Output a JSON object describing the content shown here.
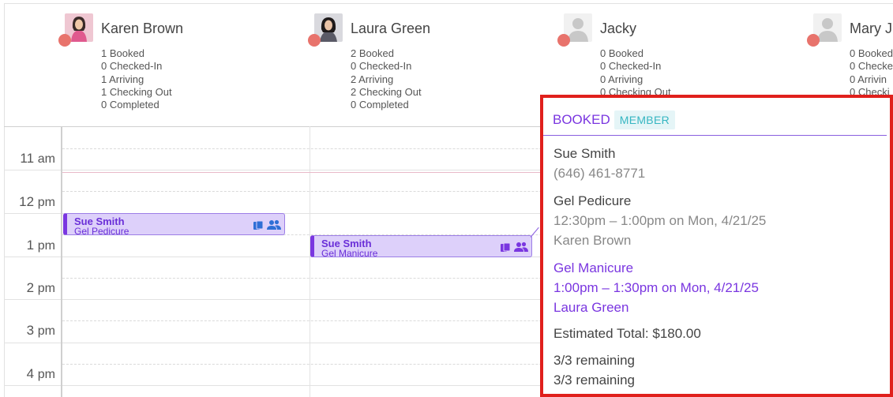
{
  "staff": [
    {
      "name": "Karen Brown",
      "avatar": "photo",
      "stats": [
        "1 Booked",
        "0 Checked-In",
        "1 Arriving",
        "1 Checking Out",
        "0 Completed"
      ]
    },
    {
      "name": "Laura Green",
      "avatar": "photo",
      "stats": [
        "2 Booked",
        "0 Checked-In",
        "2 Arriving",
        "2 Checking Out",
        "0 Completed"
      ]
    },
    {
      "name": "Jacky",
      "avatar": "placeholder",
      "stats": [
        "0 Booked",
        "0 Checked-In",
        "0 Arriving",
        "0 Checking Out"
      ]
    },
    {
      "name": "Mary J",
      "avatar": "placeholder",
      "stats": [
        "0 Booked",
        "0 Checke",
        "0 Arrivin",
        "0 Checki"
      ]
    }
  ],
  "times": [
    {
      "num": "11",
      "unit": "am"
    },
    {
      "num": "12",
      "unit": "pm"
    },
    {
      "num": "1",
      "unit": "pm"
    },
    {
      "num": "2",
      "unit": "pm"
    },
    {
      "num": "3",
      "unit": "pm"
    },
    {
      "num": "4",
      "unit": "pm"
    }
  ],
  "appointments": [
    {
      "client": "Sue Smith",
      "service": "Gel Pedicure"
    },
    {
      "client": "Sue Smith",
      "service": "Gel Manicure"
    }
  ],
  "popover": {
    "status": "BOOKED",
    "badge": "MEMBER",
    "client_name": "Sue Smith",
    "client_phone": "(646) 461-8771",
    "service1": {
      "name": "Gel Pedicure",
      "time": "12:30pm – 1:00pm on Mon, 4/21/25",
      "staff": "Karen Brown"
    },
    "service2": {
      "name": "Gel Manicure",
      "time": "1:00pm – 1:30pm on Mon, 4/21/25",
      "staff": "Laura Green"
    },
    "estimated_total": "Estimated Total: $180.00",
    "remaining": [
      "3/3 remaining",
      "3/3 remaining"
    ]
  },
  "colors": {
    "status_dot": "#e8736c",
    "appointment_fill": "#ddd0fa",
    "appointment_accent": "#7a36e0",
    "popover_border": "#e0201c",
    "member_badge_text": "#36b6c2"
  },
  "icons": [
    "status-dot",
    "product-bag-icon",
    "group-icon"
  ]
}
